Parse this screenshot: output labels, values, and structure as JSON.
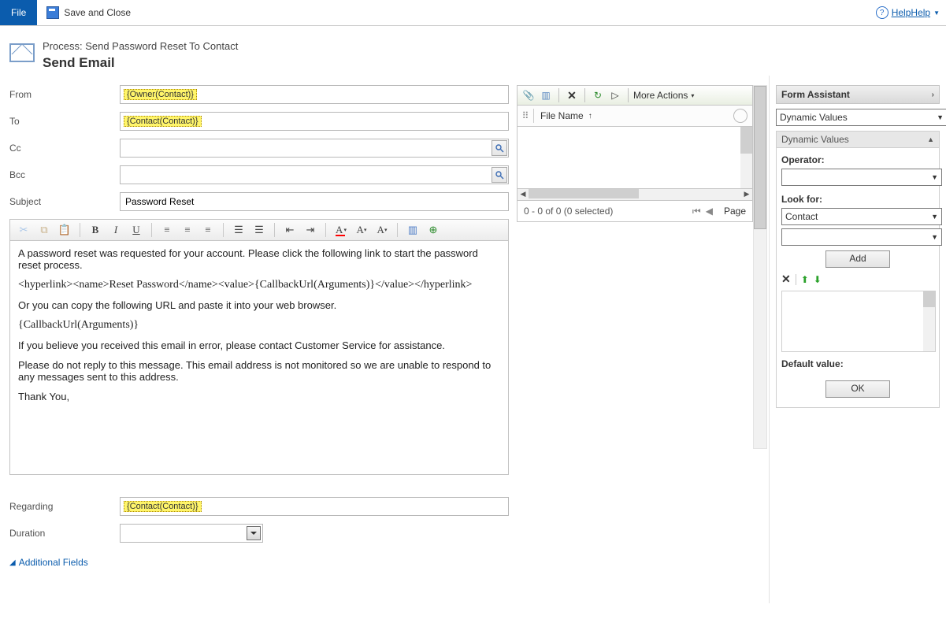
{
  "toolbar": {
    "file_label": "File",
    "save_close_label": "Save and Close",
    "help_label": "Help"
  },
  "header": {
    "process_prefix": "Process: ",
    "process_name": "Send Password Reset To Contact",
    "page_title": "Send Email"
  },
  "form": {
    "from_label": "From",
    "to_label": "To",
    "cc_label": "Cc",
    "bcc_label": "Bcc",
    "subject_label": "Subject",
    "regarding_label": "Regarding",
    "duration_label": "Duration",
    "from_value": "{Owner(Contact)}",
    "to_value": "{Contact(Contact)}",
    "subject_value": "Password Reset",
    "regarding_value": "{Contact(Contact)}",
    "additional_fields_label": "Additional Fields"
  },
  "body": {
    "p1": "A password reset was requested for your account. Please click the following link to start the password reset process.",
    "p2": "<hyperlink><name>Reset Password</name><value>{CallbackUrl(Arguments)}</value></hyperlink>",
    "p3": "Or you can copy the following URL and paste it into your web browser.",
    "p4": "{CallbackUrl(Arguments)}",
    "p5": "If you believe you received this email in error, please contact Customer Service for assistance.",
    "p6": "Please do not reply to this message. This email address is not monitored so we are unable to respond to any messages sent to this address.",
    "p7": "Thank You,"
  },
  "attachments": {
    "more_actions_label": "More Actions",
    "file_name_label": "File Name",
    "sort_indicator": "↑",
    "status_text": "0 - 0 of 0 (0 selected)",
    "page_label": "Page"
  },
  "assistant": {
    "header": "Form Assistant",
    "dropdown1": "Dynamic Values",
    "subheader": "Dynamic Values",
    "operator_label": "Operator:",
    "look_for_label": "Look for:",
    "look_for_value": "Contact",
    "add_label": "Add",
    "default_value_label": "Default value:",
    "ok_label": "OK"
  }
}
